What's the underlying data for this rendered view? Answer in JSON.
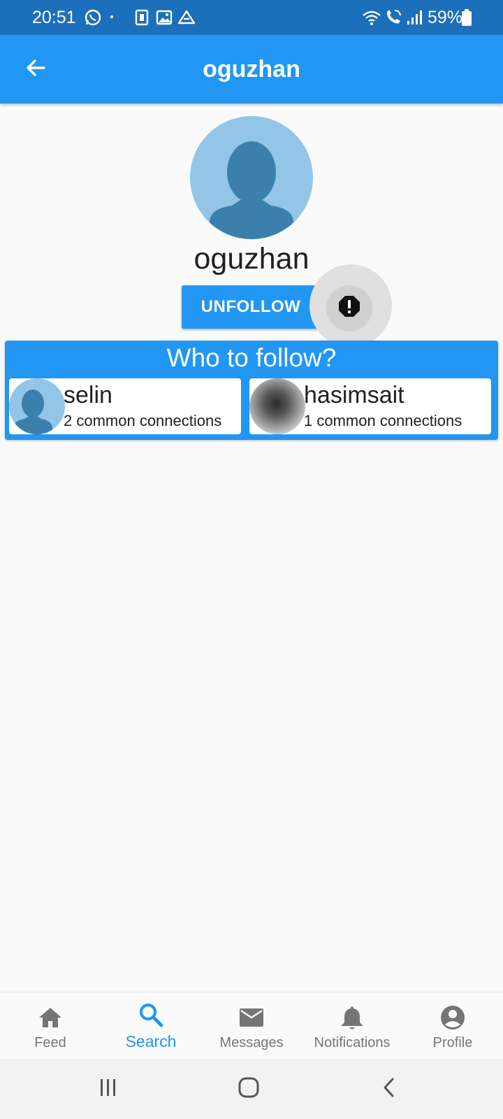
{
  "status_bar": {
    "time": "20:51",
    "battery_percent": "59%",
    "color": "#1c6fba",
    "icons": [
      "whatsapp-icon",
      "dot-icon",
      "sim-icon",
      "gallery-icon",
      "drive-icon",
      "wifi-icon",
      "wifi-call-icon",
      "signal-icon",
      "battery-icon"
    ]
  },
  "app_bar": {
    "title": "oguzhan",
    "color": "#2196f3",
    "back_icon": "arrow-back-icon"
  },
  "profile": {
    "name": "oguzhan",
    "unfollow_label": "UNFOLLOW",
    "report_icon": "report-icon"
  },
  "who_to_follow": {
    "title": "Who to follow?",
    "suggestions": [
      {
        "name": "selin",
        "subtitle": "2 common connections",
        "avatar": "default-avatar"
      },
      {
        "name": "hasimsait",
        "subtitle": "1 common connections",
        "avatar": "blurred-photo"
      }
    ]
  },
  "bottom_nav": {
    "active": "Search",
    "active_color": "#2196f3",
    "items": [
      {
        "label": "Feed",
        "icon": "home-icon"
      },
      {
        "label": "Search",
        "icon": "search-icon"
      },
      {
        "label": "Messages",
        "icon": "mail-icon"
      },
      {
        "label": "Notifications",
        "icon": "bell-icon"
      },
      {
        "label": "Profile",
        "icon": "account-circle-icon"
      }
    ]
  },
  "system_nav": {
    "icons": [
      "recents-icon",
      "home-button-icon",
      "back-button-icon"
    ]
  }
}
